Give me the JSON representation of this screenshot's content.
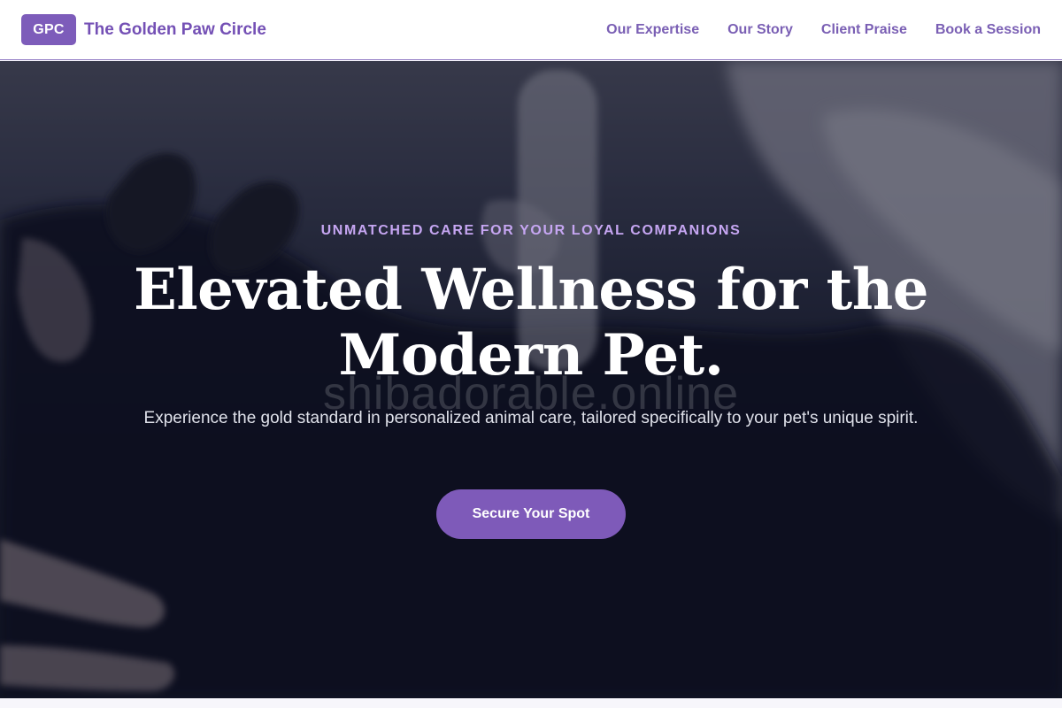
{
  "header": {
    "brand_badge": "GPC",
    "brand_name": "The Golden Paw Circle",
    "nav": [
      {
        "label": "Our Expertise"
      },
      {
        "label": "Our Story"
      },
      {
        "label": "Client Praise"
      },
      {
        "label": "Book a Session"
      }
    ]
  },
  "hero": {
    "eyebrow": "UNMATCHED CARE FOR YOUR LOYAL COMPANIONS",
    "headline_line1": "Elevated Wellness for the",
    "headline_line2": "Modern Pet.",
    "watermark": "shibadorable.online",
    "subtext": "Experience the gold standard in personalized animal care, tailored specifically to your pet's unique spirit.",
    "cta_label": "Secure Your Spot"
  },
  "colors": {
    "accent": "#7e5ab9",
    "eyebrow": "#c6a6f2",
    "nav_text": "#7a5fb4"
  }
}
